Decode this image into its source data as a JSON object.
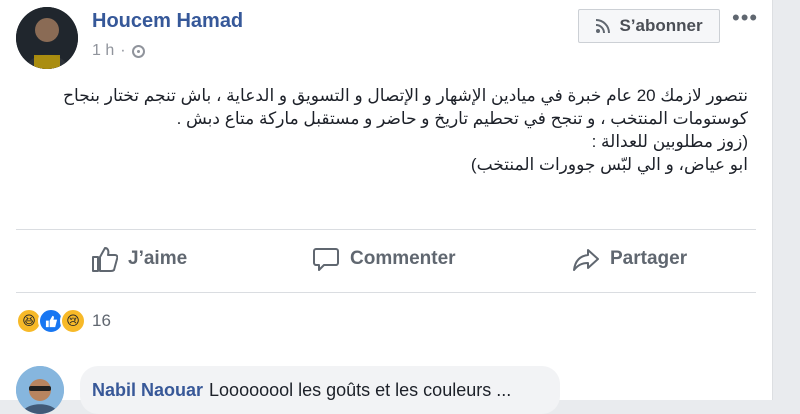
{
  "post": {
    "author": "Houcem Hamad",
    "time": "1 h",
    "subscribe_label": "S’abonner",
    "more_label": "•••",
    "body_lines": [
      "نتصور لازمك 20 عام خبرة في ميادين الإشهار و الإتصال و التسويق و الدعاية ، باش تنجم تختار بنجاح",
      "كوستومات المنتخب ، و تنجح في تحطيم تاريخ و حاضر و مستقبل ماركة متاع دبش .",
      "(زوز مطلوبين للعدالة :",
      "ابو عياض، و الي لبّس جوورات المنتخب)"
    ]
  },
  "actions": {
    "like": "J’aime",
    "comment": "Commenter",
    "share": "Partager"
  },
  "reactions": {
    "count": "16",
    "types": [
      "haha",
      "like",
      "sad"
    ]
  },
  "comment": {
    "author": "Nabil Naouar",
    "text": "Loooooool les goûts et les couleurs ..."
  },
  "colors": {
    "link": "#365899",
    "like_blue": "#1877f2",
    "haha_yellow": "#f7b928"
  }
}
